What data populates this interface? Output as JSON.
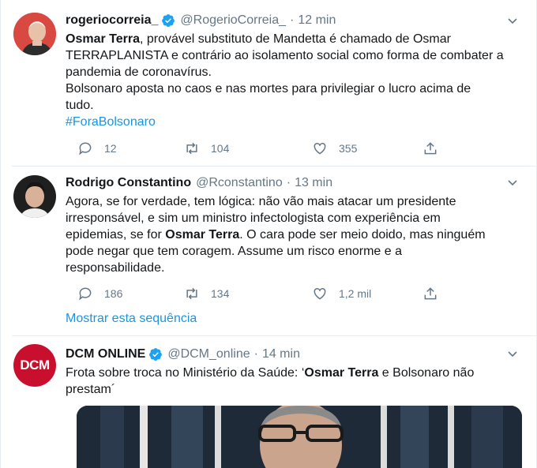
{
  "tweets": [
    {
      "display_name": "rogeriocorreia_",
      "verified": true,
      "handle": "@RogerioCorreia_",
      "separator": "·",
      "time": "12 min",
      "text_parts": {
        "bold1": "Osmar Terra",
        "p1": ", provável substituto de Mandetta é chamado de Osmar",
        "p2": "TERRAPLANISTA e contrário ao isolamento social como forma de combater a",
        "p3": "pandemia de coronavírus.",
        "p4": "Bolsonaro aposta no caos e nas mortes para privilegiar o lucro acima de",
        "p5": "tudo.",
        "hashtag": "#ForaBolsonaro"
      },
      "replies": "12",
      "retweets": "104",
      "likes": "355"
    },
    {
      "display_name": "Rodrigo Constantino",
      "verified": false,
      "handle": "@Rconstantino",
      "separator": "·",
      "time": "13 min",
      "text_parts": {
        "l1": "Agora, se for verdade, tem lógica: não vão mais atacar um presidente",
        "l2": "irresponsável, e sim um ministro infectologista com experiência em",
        "l3a": "epidemias, se for ",
        "l3b": "Osmar Terra",
        "l3c": ". O cara pode ser meio doido, mas ninguém",
        "l4": "pode negar que tem coragem. Assume um risco enorme e a",
        "l5": "responsabilidade."
      },
      "replies": "186",
      "retweets": "134",
      "likes": "1,2 mil",
      "show_thread": "Mostrar esta sequência"
    },
    {
      "display_name": "DCM ONLINE",
      "verified": true,
      "handle": "@DCM_online",
      "separator": "·",
      "time": "14 min",
      "avatar_text": "DCM",
      "text_parts": {
        "l1a": "Frota sobre troca no Ministério da Saúde: ‘",
        "l1b": "Osmar Terra",
        "l1c": " e Bolsonaro não",
        "l2": "prestam´"
      }
    }
  ],
  "colors": {
    "accent": "#1b95e0",
    "muted": "#657786",
    "text": "#14171a",
    "border": "#e6ecf0",
    "dcm_red": "#c8102e"
  },
  "icons": [
    "verified-badge-icon",
    "chevron-down-icon",
    "reply-icon",
    "retweet-icon",
    "like-icon",
    "share-icon"
  ]
}
